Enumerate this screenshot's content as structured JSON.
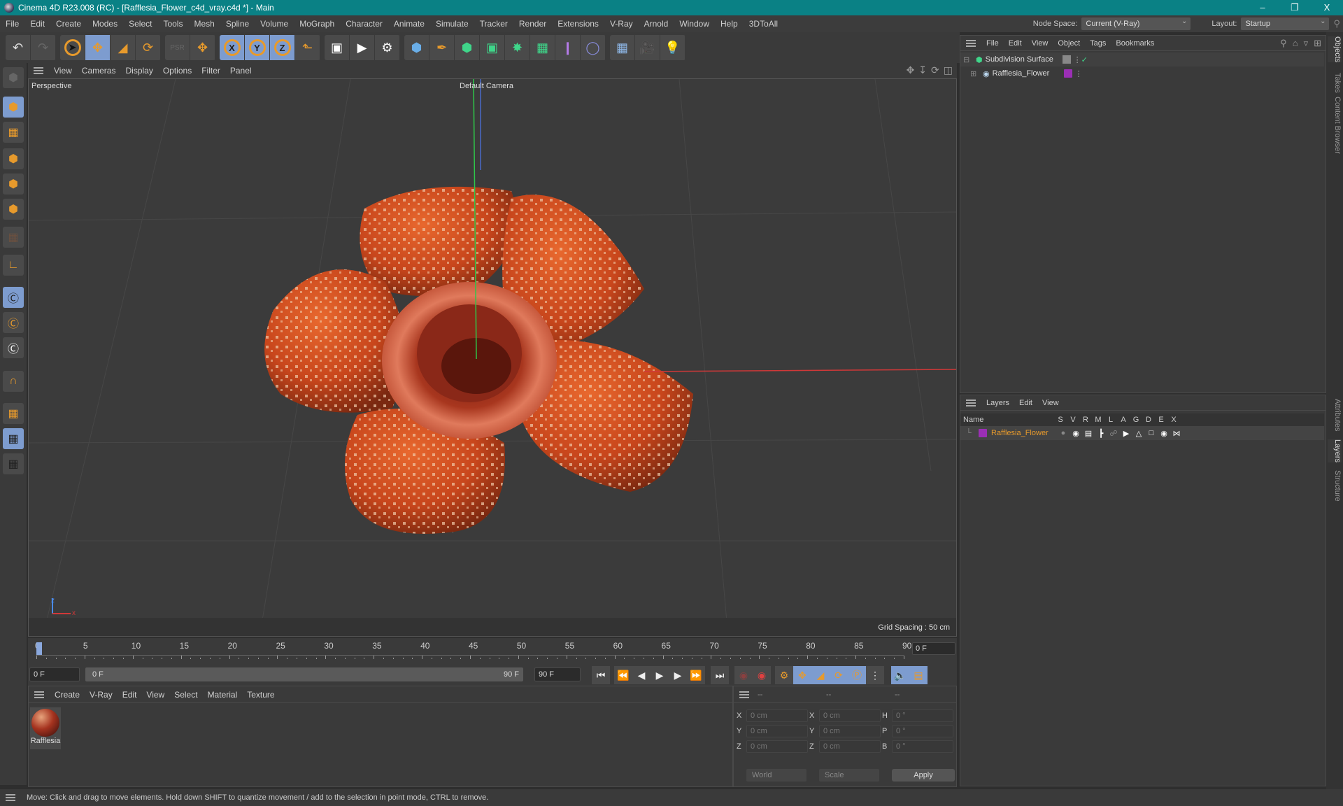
{
  "window": {
    "title": "Cinema 4D R23.008 (RC) - [Rafflesia_Flower_c4d_vray.c4d *] - Main",
    "controls": [
      "–",
      "❐",
      "X"
    ]
  },
  "menubar": {
    "items": [
      "File",
      "Edit",
      "Create",
      "Modes",
      "Select",
      "Tools",
      "Mesh",
      "Spline",
      "Volume",
      "MoGraph",
      "Character",
      "Animate",
      "Simulate",
      "Tracker",
      "Render",
      "Extensions",
      "V-Ray",
      "Arnold",
      "Window",
      "Help",
      "3DToAll"
    ],
    "node_space_label": "Node Space:",
    "node_space_value": "Current (V-Ray)",
    "layout_label": "Layout:",
    "layout_value": "Startup"
  },
  "toolbar": {
    "groups": [
      [
        "undo-icon",
        "redo-icon"
      ],
      [
        "select-icon",
        "move-icon",
        "scale-icon",
        "rotate-icon"
      ],
      [
        "psr-icon",
        "add-object-icon"
      ],
      [
        "x-axis-icon",
        "y-axis-icon",
        "z-axis-icon",
        "coordinate-system-icon"
      ],
      [
        "render-view-icon",
        "render-picture-viewer-icon",
        "render-settings-icon"
      ],
      [
        "cube-icon",
        "pen-icon",
        "subdivision-icon",
        "extrude-icon",
        "cloner-icon",
        "mograph-icon",
        "symmetry-icon",
        "deformer-icon"
      ],
      [
        "floor-icon",
        "camera-icon",
        "light-icon"
      ]
    ],
    "axis_labels": [
      "X",
      "Y",
      "Z"
    ]
  },
  "lefttools": [
    "make-editable-icon",
    "model-mode-icon",
    "texture-mode-icon",
    "point-mode-icon",
    "edge-mode-icon",
    "polygon-mode-icon",
    "uv-mode-icon",
    "axis-mode-icon",
    "snap-icon",
    "snap-settings-icon",
    "snap-enable-icon",
    "magnet-icon",
    "workplane-icon",
    "lock-workplane-icon",
    "workplane-align-icon"
  ],
  "viewport": {
    "menu": [
      "View",
      "Cameras",
      "Display",
      "Options",
      "Filter",
      "Panel"
    ],
    "projection": "Perspective",
    "camera": "Default Camera",
    "grid_spacing": "Grid Spacing : 50 cm",
    "axis_x": "x",
    "axis_z": "z"
  },
  "timeline": {
    "ticks": [
      0,
      5,
      10,
      15,
      20,
      25,
      30,
      35,
      40,
      45,
      50,
      55,
      60,
      65,
      70,
      75,
      80,
      85,
      90
    ],
    "current_frame": "0 F",
    "end_field": "0 F",
    "start_field": "0 F",
    "range_start": "0 F",
    "range_end": "90 F",
    "max_field": "90 F"
  },
  "material_manager": {
    "menu": [
      "Create",
      "V-Ray",
      "Edit",
      "View",
      "Select",
      "Material",
      "Texture"
    ],
    "materials": [
      {
        "name": "Rafflesia"
      }
    ]
  },
  "coordinates": {
    "headers": [
      "--",
      "--",
      "--"
    ],
    "rows": [
      {
        "a": "X",
        "v1": "0 cm",
        "b": "X",
        "v2": "0 cm",
        "c": "H",
        "v3": "0 °"
      },
      {
        "a": "Y",
        "v1": "0 cm",
        "b": "Y",
        "v2": "0 cm",
        "c": "P",
        "v3": "0 °"
      },
      {
        "a": "Z",
        "v1": "0 cm",
        "b": "Z",
        "v2": "0 cm",
        "c": "B",
        "v3": "0 °"
      }
    ],
    "space": "World",
    "mode": "Scale",
    "apply": "Apply"
  },
  "object_manager": {
    "menu": [
      "File",
      "Edit",
      "View",
      "Object",
      "Tags",
      "Bookmarks"
    ],
    "objects": [
      {
        "name": "Subdivision Surface",
        "level": 0
      },
      {
        "name": "Rafflesia_Flower",
        "level": 1
      }
    ]
  },
  "layer_manager": {
    "menu": [
      "Layers",
      "Edit",
      "View"
    ],
    "columns": [
      "Name",
      "S",
      "V",
      "R",
      "M",
      "L",
      "A",
      "G",
      "D",
      "E",
      "X"
    ],
    "layers": [
      {
        "name": "Rafflesia_Flower",
        "color": "#9b2fb5"
      }
    ]
  },
  "side_tabs_top": [
    "Objects",
    "Takes",
    "Content Browser"
  ],
  "side_tabs_bottom": [
    "Attributes",
    "Layers",
    "Structure"
  ],
  "status": "Move: Click and drag to move elements. Hold down SHIFT to quantize movement / add to the selection in point mode, CTRL to remove.",
  "colors": {
    "accent": "#e79a2c",
    "active": "#7d9ccf",
    "titlebar": "#0a8185",
    "layer": "#9b2fb5"
  }
}
